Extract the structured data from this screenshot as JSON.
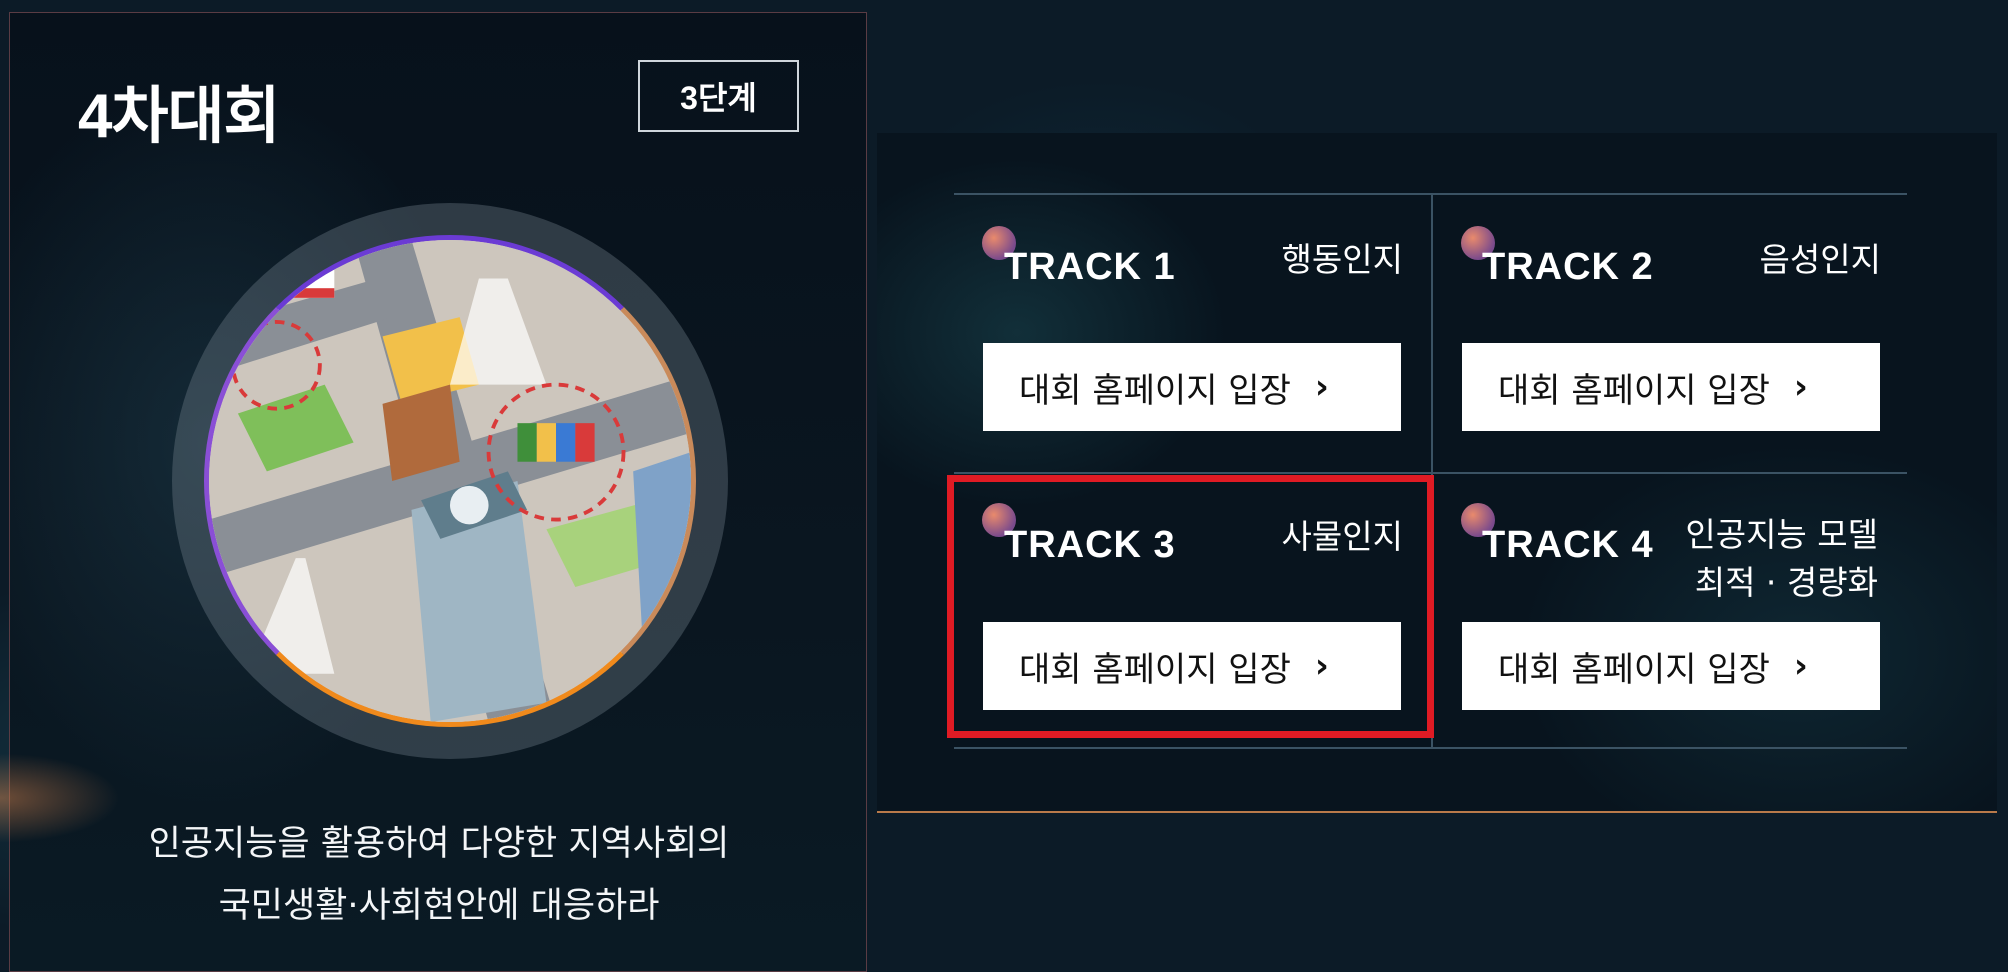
{
  "competition": {
    "title": "4차대회",
    "stage_badge": "3단계",
    "description_line1": "인공지능을 활용하여 다양한 지역사회의",
    "description_line2": "국민생활·사회현안에 대응하라"
  },
  "tracks": [
    {
      "label": "TRACK 1",
      "name_line1": "행동인지",
      "name_line2": "",
      "button": "대회 홈페이지 입장",
      "chevron": "›"
    },
    {
      "label": "TRACK 2",
      "name_line1": "음성인지",
      "name_line2": "",
      "button": "대회 홈페이지 입장",
      "chevron": "›"
    },
    {
      "label": "TRACK 3",
      "name_line1": "사물인지",
      "name_line2": "",
      "button": "대회 홈페이지 입장",
      "chevron": "›"
    },
    {
      "label": "TRACK 4",
      "name_line1": "인공지능 모델",
      "name_line2": "최적 · 경량화",
      "button": "대회 홈페이지 입장",
      "chevron": "›"
    }
  ],
  "colors": {
    "background": "#0c1b27",
    "highlight": "#e01b24",
    "button_bg": "#ffffff",
    "circle_border_top": "#6b3bd4",
    "circle_border_bottom": "#f08a1c"
  },
  "icons": {
    "track_dot": "gradient-dot-icon",
    "chevron": "chevron-right-icon",
    "illustration": "smart-city-illustration"
  }
}
